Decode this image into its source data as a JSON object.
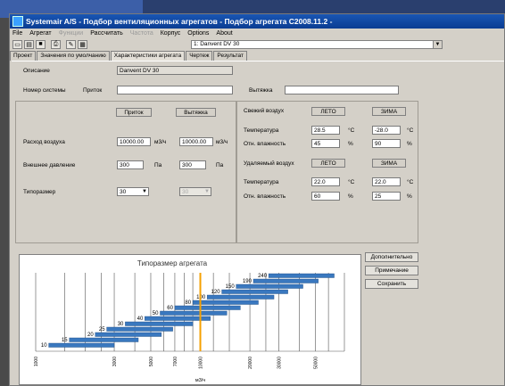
{
  "window": {
    "title": "Systemair A/S - Подбор вентиляционных агрегатов - Подбор агрегата C2008.11.2 -"
  },
  "menu": {
    "items": [
      {
        "label": "File",
        "enabled": true
      },
      {
        "label": "Агрегат",
        "enabled": true
      },
      {
        "label": "Функции",
        "enabled": false
      },
      {
        "label": "Рассчитать",
        "enabled": true
      },
      {
        "label": "Частота",
        "enabled": false
      },
      {
        "label": "Корпус",
        "enabled": true
      },
      {
        "label": "Options",
        "enabled": true
      },
      {
        "label": "About",
        "enabled": true
      }
    ]
  },
  "toolbar": {
    "unit_select": "1: Danvent DV 30"
  },
  "tabs": [
    {
      "label": "Проект",
      "active": false
    },
    {
      "label": "Значения по умолчанию",
      "active": false
    },
    {
      "label": "Характеристики агрегата",
      "active": true
    },
    {
      "label": "Чертеж",
      "active": false
    },
    {
      "label": "Результат",
      "active": false
    }
  ],
  "form": {
    "description_label": "Описание",
    "description_value": "Danvent DV 30",
    "system_label": "Номер системы",
    "supply_label": "Приток",
    "supply_value": "",
    "exhaust_label": "Вытяжка",
    "exhaust_value": "",
    "col_supply": "Приток",
    "col_exhaust": "Вытяжка",
    "airflow_label": "Расход воздуха",
    "airflow_supply": "10000.00",
    "airflow_exhaust": "10000.00",
    "airflow_unit": "м3/ч",
    "pressure_label": "Внешнее давление",
    "pressure_supply": "300",
    "pressure_exhaust": "300",
    "pressure_unit": "Па",
    "size_label": "Типоразмер",
    "size_supply": "30",
    "size_exhaust": "30"
  },
  "climate": {
    "fresh_label": "Свежий воздух",
    "summer": "ЛЕТО",
    "winter": "ЗИМА",
    "temp_label": "Температура",
    "humidity_label": "Отн. влажность",
    "fresh_temp_summer": "28.5",
    "fresh_temp_winter": "-28.0",
    "fresh_hum_summer": "45",
    "fresh_hum_winter": "90",
    "removed_label": "Удаляемый воздух",
    "removed_temp_summer": "22.0",
    "removed_temp_winter": "22.0",
    "removed_hum_summer": "60",
    "removed_hum_winter": "25",
    "temp_unit": "°С",
    "hum_unit": "%"
  },
  "buttons": {
    "more": "Дополнительно",
    "note": "Примечание",
    "save": "Сохранить"
  },
  "chart_data": {
    "type": "bar",
    "title": "Типоразмер агрегата",
    "xlabel": "м3/ч",
    "orientation": "horizontal",
    "categories": [
      "10",
      "15",
      "20",
      "25",
      "30",
      "40",
      "50",
      "60",
      "80",
      "100",
      "120",
      "150",
      "190",
      "240"
    ],
    "ranges": [
      [
        1200,
        3000
      ],
      [
        1600,
        4200
      ],
      [
        2300,
        5800
      ],
      [
        2700,
        6800
      ],
      [
        3500,
        9000
      ],
      [
        4600,
        11500
      ],
      [
        5700,
        14500
      ],
      [
        7000,
        17500
      ],
      [
        9000,
        22500
      ],
      [
        11000,
        28000
      ],
      [
        13500,
        34000
      ],
      [
        16500,
        42000
      ],
      [
        21000,
        52000
      ],
      [
        26000,
        65000
      ]
    ],
    "marker_value": 10000,
    "marker_color": "#f5a000",
    "bar_color": "#3a78bf",
    "x_ticks": [
      "1000",
      "3000",
      "5000",
      "7000",
      "10000",
      "20000",
      "30000",
      "50000"
    ]
  }
}
